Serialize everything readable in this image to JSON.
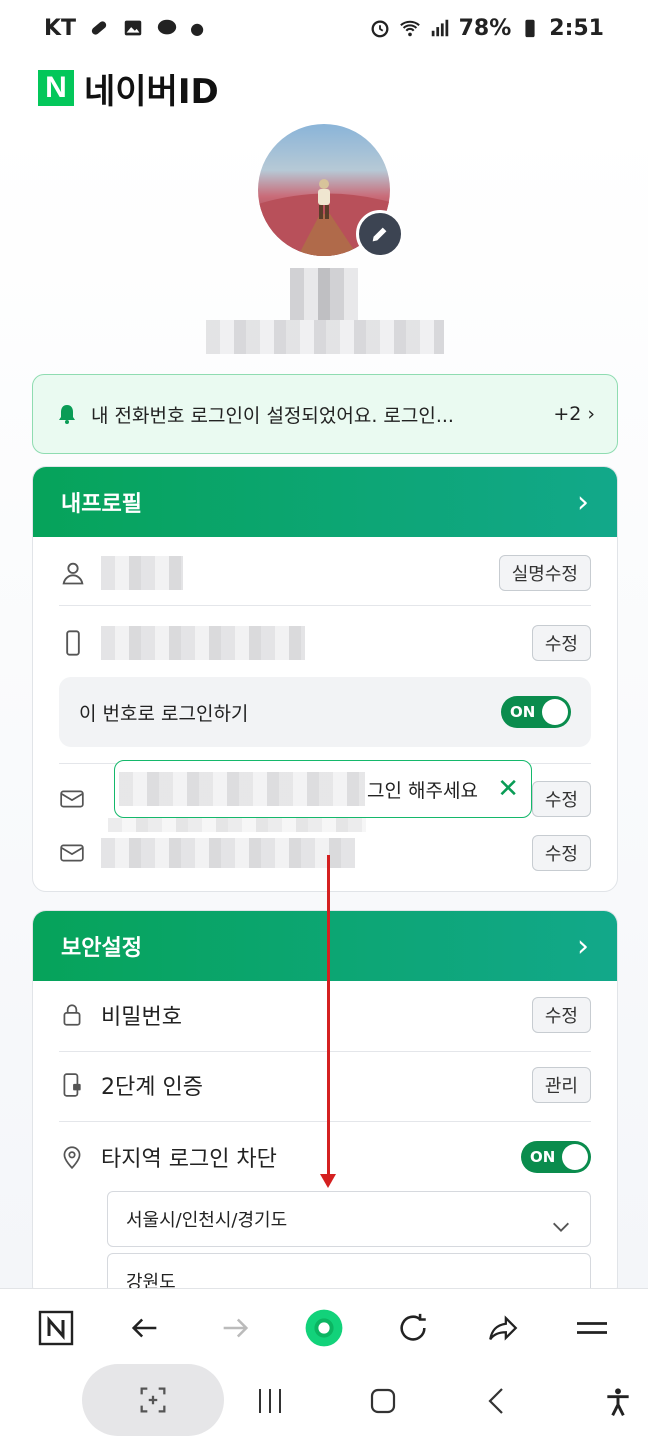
{
  "status_bar": {
    "carrier": "KT",
    "battery": "78%",
    "time": "2:51"
  },
  "header": {
    "logo_letter": "N",
    "title": "네이버ID"
  },
  "notice": {
    "text": "내 전화번호 로그인이 설정되었어요. 로그인...",
    "more": "+2"
  },
  "profile_card": {
    "title": "내프로필",
    "name_button": "실명수정",
    "phone_button": "수정",
    "phone_login_label": "이 번호로 로그인하기",
    "phone_login_toggle": "ON",
    "email1_button": "수정",
    "email2_button": "수정"
  },
  "tooltip": {
    "text": "그인 해주세요"
  },
  "security_card": {
    "title": "보안설정",
    "password_label": "비밀번호",
    "password_button": "수정",
    "twofactor_label": "2단계 인증",
    "twofactor_button": "관리",
    "region_block_label": "타지역 로그인 차단",
    "region_block_toggle": "ON",
    "region_option_1": "서울시/인천시/경기도",
    "region_option_2": "강원도"
  },
  "colors": {
    "brand_green": "#03c75a",
    "header_green": "#06a35a",
    "annotation_red": "#d42020"
  }
}
